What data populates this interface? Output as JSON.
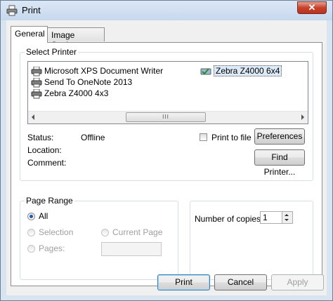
{
  "window": {
    "title": "Print",
    "close_symbol": "✕"
  },
  "tabs": [
    {
      "label": "General",
      "active": true
    },
    {
      "label": "Image Settings",
      "active": false
    }
  ],
  "select_printer": {
    "legend": "Select Printer",
    "printers": [
      {
        "name": "Microsoft XPS Document Writer",
        "icon": "printer-icon",
        "selected": false
      },
      {
        "name": "Send To OneNote 2013",
        "icon": "printer-icon",
        "selected": false
      },
      {
        "name": "Zebra Z4000 4x3",
        "icon": "printer-icon",
        "selected": false
      },
      {
        "name": "Zebra Z4000 6x4",
        "icon": "printer-check-icon",
        "selected": true
      }
    ],
    "scroll_thumb_grip": "III",
    "status_label": "Status:",
    "status_value": "Offline",
    "location_label": "Location:",
    "comment_label": "Comment:",
    "print_to_file_label": "Print to file",
    "print_to_file_checked": false,
    "preferences_label": "Preferences",
    "find_printer_label": "Find Printer..."
  },
  "page_range": {
    "legend": "Page Range",
    "all_label": "All",
    "selection_label": "Selection",
    "current_page_label": "Current Page",
    "pages_label": "Pages:",
    "pages_value": "",
    "selected": "All"
  },
  "copies": {
    "label": "Number of copies:",
    "value": "1"
  },
  "footer": {
    "print_label": "Print",
    "cancel_label": "Cancel",
    "apply_label": "Apply"
  }
}
